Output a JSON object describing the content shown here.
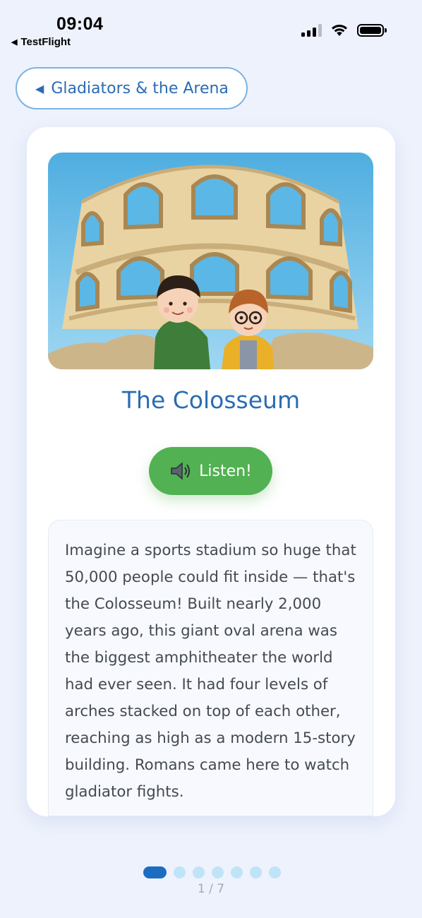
{
  "status_bar": {
    "time": "09:04",
    "back_app": "TestFlight",
    "signal_icon": "cellular-signal-icon",
    "wifi_icon": "wifi-icon",
    "battery_icon": "battery-icon"
  },
  "nav": {
    "back_label": "Gladiators & the Arena",
    "back_icon": "back-triangle-icon"
  },
  "card": {
    "image_alt": "colosseum-illustration",
    "title": "The Colosseum",
    "listen_label": "Listen!",
    "listen_icon": "speaker-icon",
    "body": "Imagine a sports stadium so huge that 50,000 people could fit inside — that's the Colosseum! Built nearly 2,000 years ago, this giant oval arena was the biggest amphitheater the world had ever seen. It had four levels of arches stacked on top of each other, reaching as high as a modern 15-story building. Romans came here to watch gladiator fights."
  },
  "pagination": {
    "current": 1,
    "total": 7,
    "label": "1 / 7"
  },
  "colors": {
    "accent_blue": "#2a6cb4",
    "listen_green": "#52b152",
    "active_dot": "#1c6dc1",
    "inactive_dot": "#bfe4f7",
    "background": "#eef2fc"
  }
}
